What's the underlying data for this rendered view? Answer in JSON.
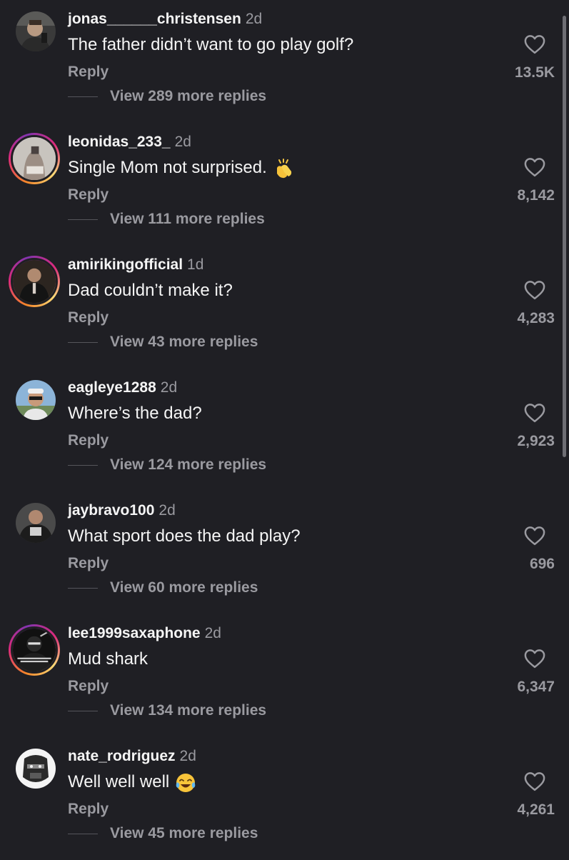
{
  "reply_label": "Reply",
  "comments": [
    {
      "username": "jonas______christensen",
      "time": "2d",
      "text": "The father didn’t want to go play golf?",
      "emoji": "",
      "likes": "13.5K",
      "view_replies": "View 289 more replies",
      "has_story": false
    },
    {
      "username": "leonidas_233_",
      "time": "2d",
      "text": "Single Mom not surprised.",
      "emoji": "clapping-hands-icon",
      "likes": "8,142",
      "view_replies": "View 111 more replies",
      "has_story": true
    },
    {
      "username": "amirikingofficial",
      "time": "1d",
      "text": "Dad couldn’t make it?",
      "emoji": "",
      "likes": "4,283",
      "view_replies": "View 43 more replies",
      "has_story": true
    },
    {
      "username": "eagleye1288",
      "time": "2d",
      "text": "Where’s the dad?",
      "emoji": "",
      "likes": "2,923",
      "view_replies": "View 124 more replies",
      "has_story": false
    },
    {
      "username": "jaybravo100",
      "time": "2d",
      "text": "What sport does the dad play?",
      "emoji": "",
      "likes": "696",
      "view_replies": "View 60 more replies",
      "has_story": false
    },
    {
      "username": "lee1999saxaphone",
      "time": "2d",
      "text": "Mud shark",
      "emoji": "",
      "likes": "6,347",
      "view_replies": "View 134 more replies",
      "has_story": true
    },
    {
      "username": "nate_rodriguez",
      "time": "2d",
      "text": "Well well well",
      "emoji": "tears-of-joy-icon",
      "likes": "4,261",
      "view_replies": "View 45 more replies",
      "has_story": false
    }
  ],
  "colors": {
    "background": "#1f1f24",
    "primary_text": "#f5f5f5",
    "secondary_text": "#9a9aa0",
    "story_ring": "#dd2a7b"
  }
}
